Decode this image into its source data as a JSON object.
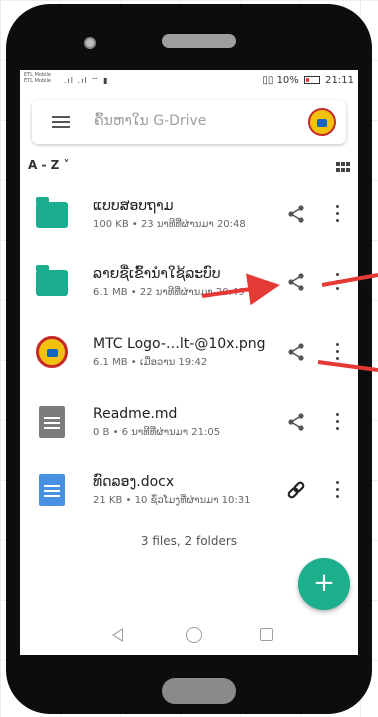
{
  "status_bar": {
    "carrier_line1": "ETL Mobile",
    "carrier_line2": "ETL Mobile",
    "battery": "10%",
    "time": "21:11"
  },
  "search": {
    "placeholder": "ຄົ້ນຫາໃນ G-Drive"
  },
  "sort": {
    "label": "A - Z ˅"
  },
  "files": [
    {
      "name": "ແບບສອບຖາມ",
      "meta": "100 KB • 23 ນາທີທີ່ຜ່ານມາ 20:48",
      "icon": "folder-icon",
      "action": "share-icon"
    },
    {
      "name": "ລາຍຊື່ເຂົ້ານໍາໃຊ້ລະບົບ",
      "meta": "6.1 MB • 22 ນາທີທີ່ຜ່ານມາ 20:49",
      "icon": "folder-icon",
      "action": "share-icon"
    },
    {
      "name": "MTC Logo-…lt-@10x.png",
      "meta": "6.1 MB • ເມື່ອວານ 19:42",
      "icon": "image-thumbnail-icon",
      "action": "share-icon"
    },
    {
      "name": "Readme.md",
      "meta": "0 B • 6 ນາທີທີ່ຜ່ານມາ 21:05",
      "icon": "document-icon",
      "action": "share-icon"
    },
    {
      "name": "ທົດລອງ.docx",
      "meta": "21 KB • 10 ຊົ່ວໂມງທີ່ຜ່ານມາ 10:31",
      "icon": "docx-icon",
      "action": "link-icon"
    }
  ],
  "summary": "3 files, 2 folders",
  "fab": {
    "label": "+"
  },
  "colors": {
    "accent": "#1dae8c",
    "arrow": "#e53935"
  }
}
